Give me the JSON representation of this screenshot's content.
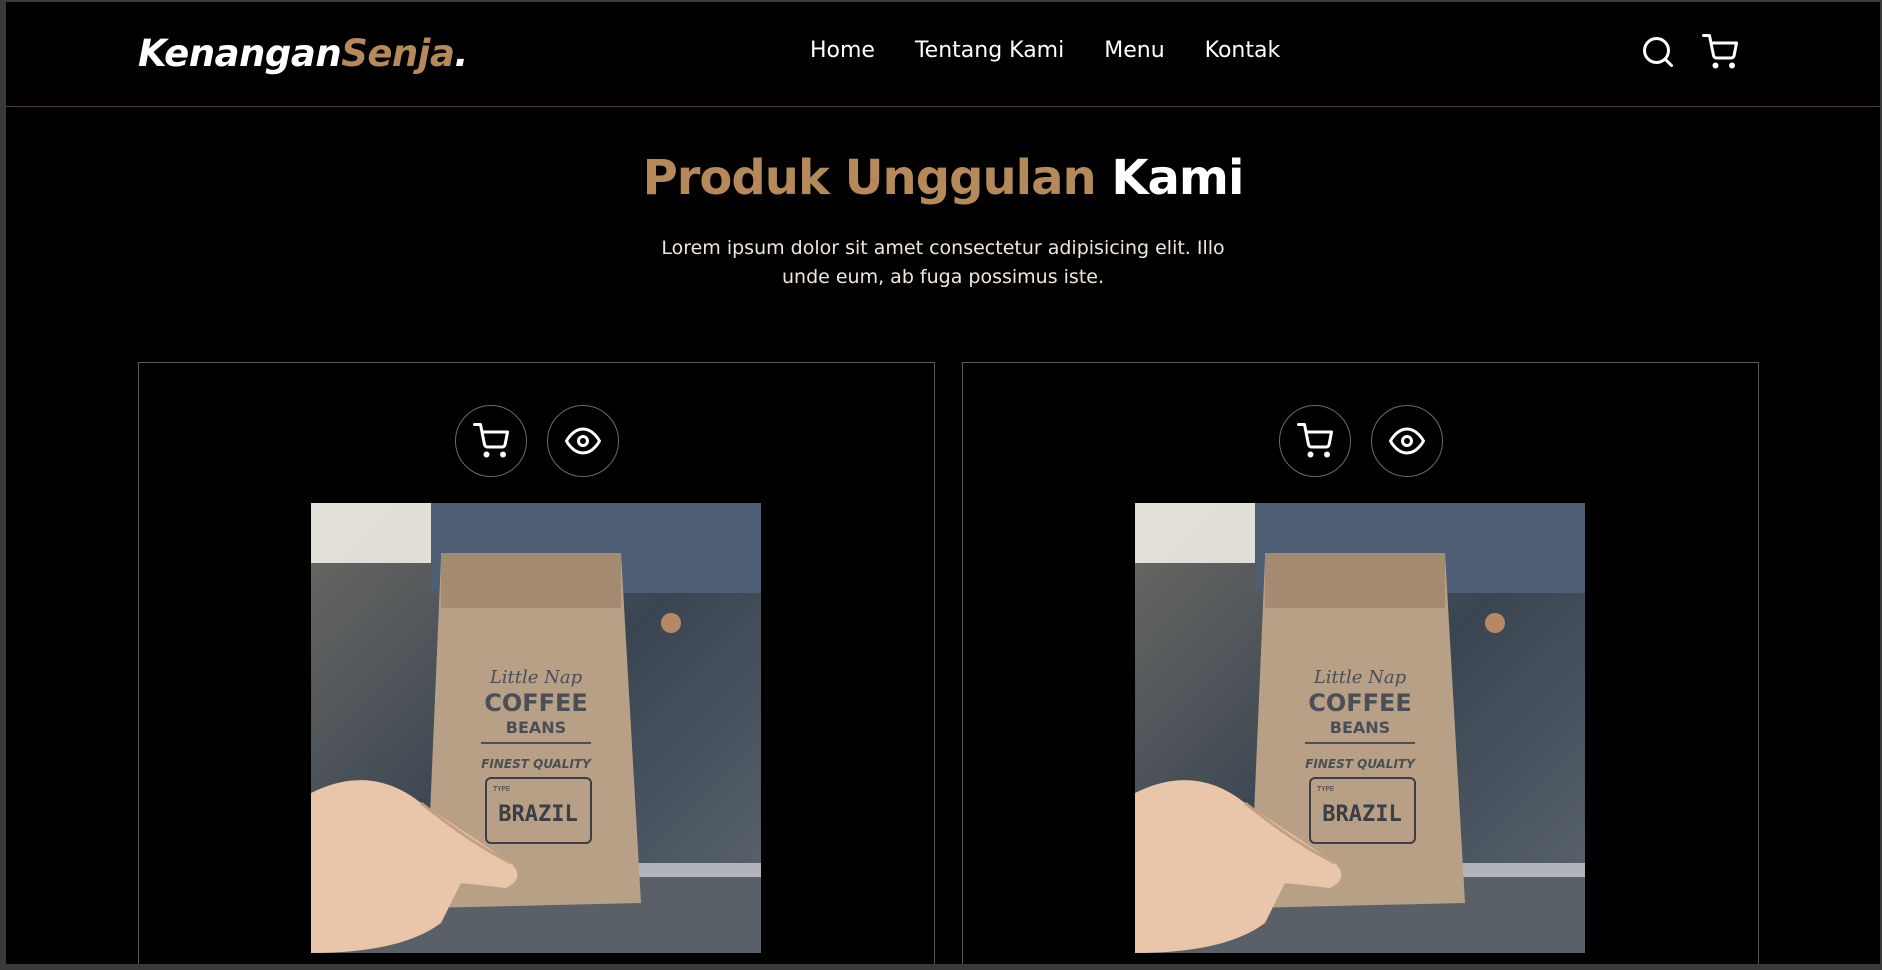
{
  "brand": {
    "part1": "Kenangan",
    "part2": "Senja",
    "part3": "."
  },
  "nav": {
    "links": [
      "Home",
      "Tentang Kami",
      "Menu",
      "Kontak"
    ],
    "icons": [
      "search-icon",
      "cart-icon"
    ]
  },
  "section": {
    "title_accent": "Produk Unggulan",
    "title_rest": "Kami",
    "subtitle_line1": "Lorem ipsum dolor sit amet consectetur adipisicing elit. Illo",
    "subtitle_line2": "unde eum, ab fuga possimus iste."
  },
  "products": [
    {
      "actions": [
        "cart-icon",
        "eye-icon"
      ],
      "bag": {
        "brand": "Little Nap",
        "line1": "COFFEE",
        "line2": "BEANS",
        "quality": "FINEST QUALITY",
        "type_label": "TYPE",
        "type": "BRAZIL"
      }
    },
    {
      "actions": [
        "cart-icon",
        "eye-icon"
      ],
      "bag": {
        "brand": "Little Nap",
        "line1": "COFFEE",
        "line2": "BEANS",
        "quality": "FINEST QUALITY",
        "type_label": "TYPE",
        "type": "BRAZIL"
      }
    }
  ],
  "colors": {
    "accent": "#b6895b",
    "background": "#000000",
    "text": "#ffffff"
  }
}
